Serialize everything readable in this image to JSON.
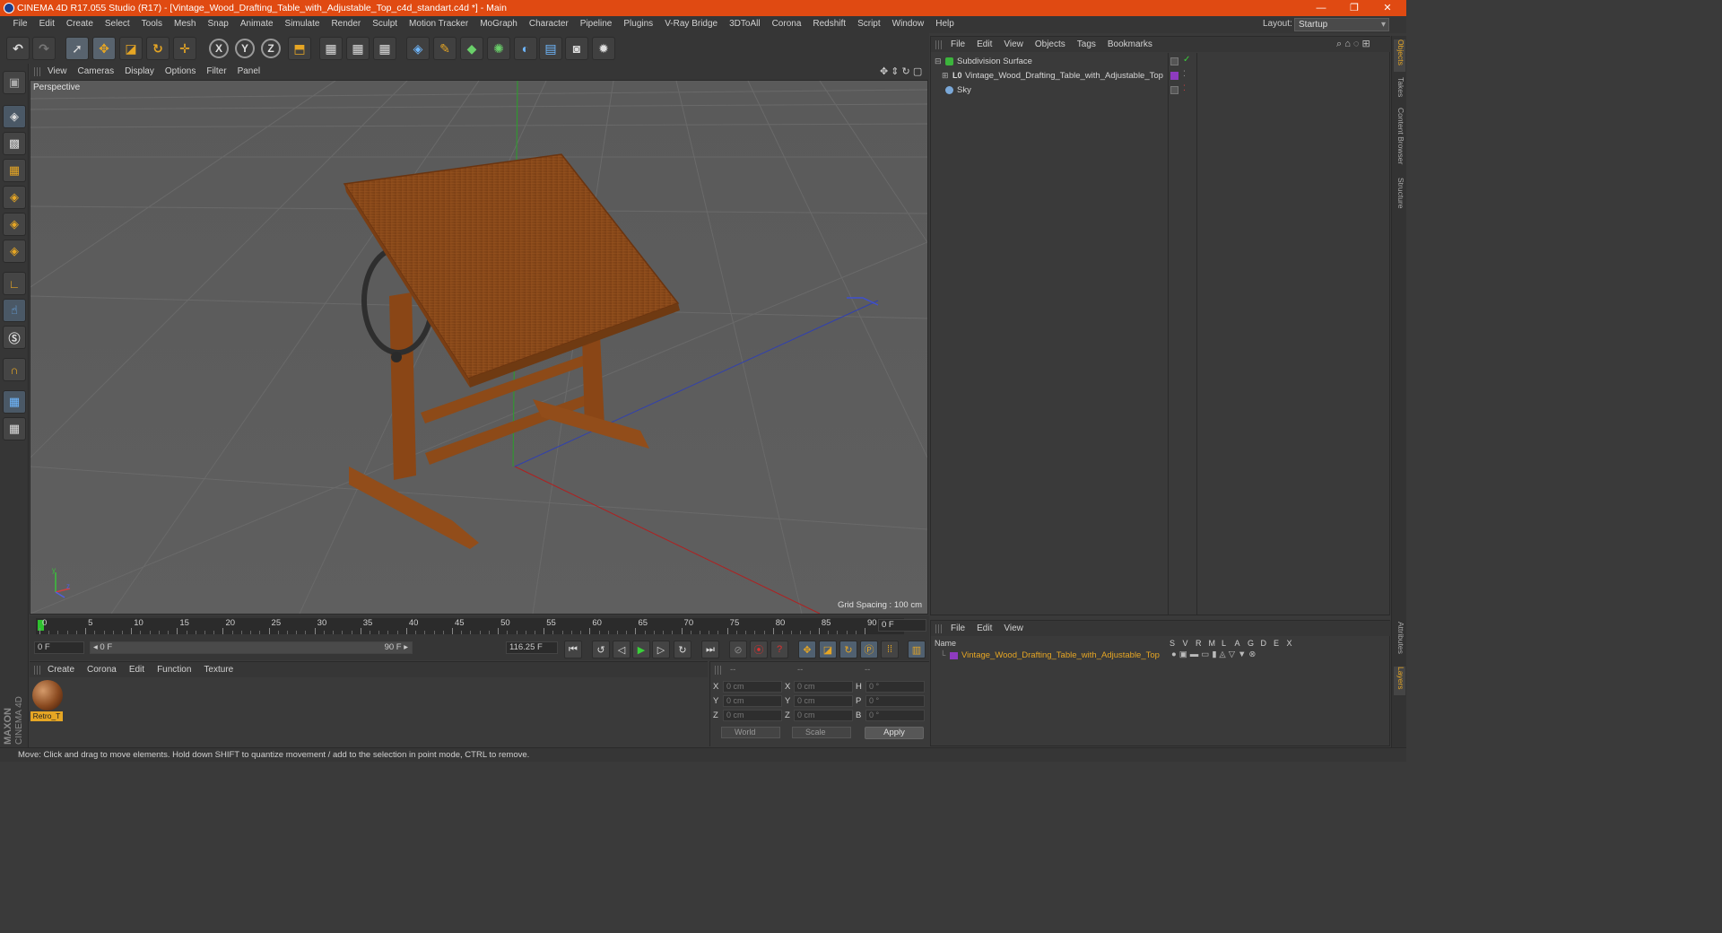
{
  "app": {
    "title": "CINEMA 4D R17.055 Studio (R17) - [Vintage_Wood_Drafting_Table_with_Adjustable_Top_c4d_standart.c4d *] - Main",
    "window_controls": [
      "—",
      "❐",
      "✕"
    ]
  },
  "menubar": {
    "items": [
      "File",
      "Edit",
      "Create",
      "Select",
      "Tools",
      "Mesh",
      "Snap",
      "Animate",
      "Simulate",
      "Render",
      "Sculpt",
      "Motion Tracker",
      "MoGraph",
      "Character",
      "Pipeline",
      "Plugins",
      "V-Ray Bridge",
      "3DToAll",
      "Corona",
      "Redshift",
      "Script",
      "Window",
      "Help"
    ],
    "layout_label": "Layout:",
    "layout_value": "Startup"
  },
  "toolbar": {
    "axis_x": "X",
    "axis_y": "Y",
    "axis_z": "Z"
  },
  "viewport": {
    "menu": [
      "View",
      "Cameras",
      "Display",
      "Options",
      "Filter",
      "Panel"
    ],
    "camera_label": "Perspective",
    "grid_spacing": "Grid Spacing : 100 cm"
  },
  "timeline": {
    "ticks": [
      "0",
      "5",
      "10",
      "15",
      "20",
      "25",
      "30",
      "35",
      "40",
      "45",
      "50",
      "55",
      "60",
      "65",
      "70",
      "75",
      "80",
      "85",
      "90"
    ],
    "current_frame": "0 F",
    "start_field": "0 F",
    "range_start": "◂ 0 F",
    "range_end": "90 F ▸",
    "end_field": "116.25 F"
  },
  "material_panel": {
    "menu": [
      "Create",
      "Corona",
      "Edit",
      "Function",
      "Texture"
    ],
    "material_name": "Retro_T"
  },
  "coordinates": {
    "headers": [
      "--",
      "--",
      "--"
    ],
    "rows": [
      {
        "a": "X",
        "v1": "0 cm",
        "b": "X",
        "v2": "0 cm",
        "c": "H",
        "v3": "0 °"
      },
      {
        "a": "Y",
        "v1": "0 cm",
        "b": "Y",
        "v2": "0 cm",
        "c": "P",
        "v3": "0 °"
      },
      {
        "a": "Z",
        "v1": "0 cm",
        "b": "Z",
        "v2": "0 cm",
        "c": "B",
        "v3": "0 °"
      }
    ],
    "mode_world": "World",
    "mode_scale": "Scale",
    "apply_label": "Apply"
  },
  "status": {
    "text": "Move: Click and drag to move elements. Hold down SHIFT to quantize movement / add to the selection in point mode, CTRL to remove."
  },
  "object_manager": {
    "menu": [
      "File",
      "Edit",
      "View",
      "Objects",
      "Tags",
      "Bookmarks"
    ],
    "objects": [
      {
        "name": "Subdivision Surface",
        "icon": "subdivision-icon"
      },
      {
        "name": "Vintage_Wood_Drafting_Table_with_Adjustable_Top",
        "icon": "null-object-icon"
      },
      {
        "name": "Sky",
        "icon": "sky-icon"
      }
    ]
  },
  "layer_manager": {
    "menu": [
      "File",
      "Edit",
      "View"
    ],
    "name_header": "Name",
    "columns": [
      "S",
      "V",
      "R",
      "M",
      "L",
      "A",
      "G",
      "D",
      "E",
      "X"
    ],
    "layer_name": "Vintage_Wood_Drafting_Table_with_Adjustable_Top"
  },
  "right_tabs": [
    "Objects",
    "Takes",
    "Content Browser",
    "Structure"
  ],
  "right_tabs_bottom": [
    "Attributes",
    "Layers"
  ],
  "brand": "MAXON CINEMA 4D",
  "colors": {
    "titlebar": "#e04a12",
    "accent": "#e6a624",
    "layer_purple": "#8e3bbf",
    "viewport_bg": "#5c5c5c"
  }
}
